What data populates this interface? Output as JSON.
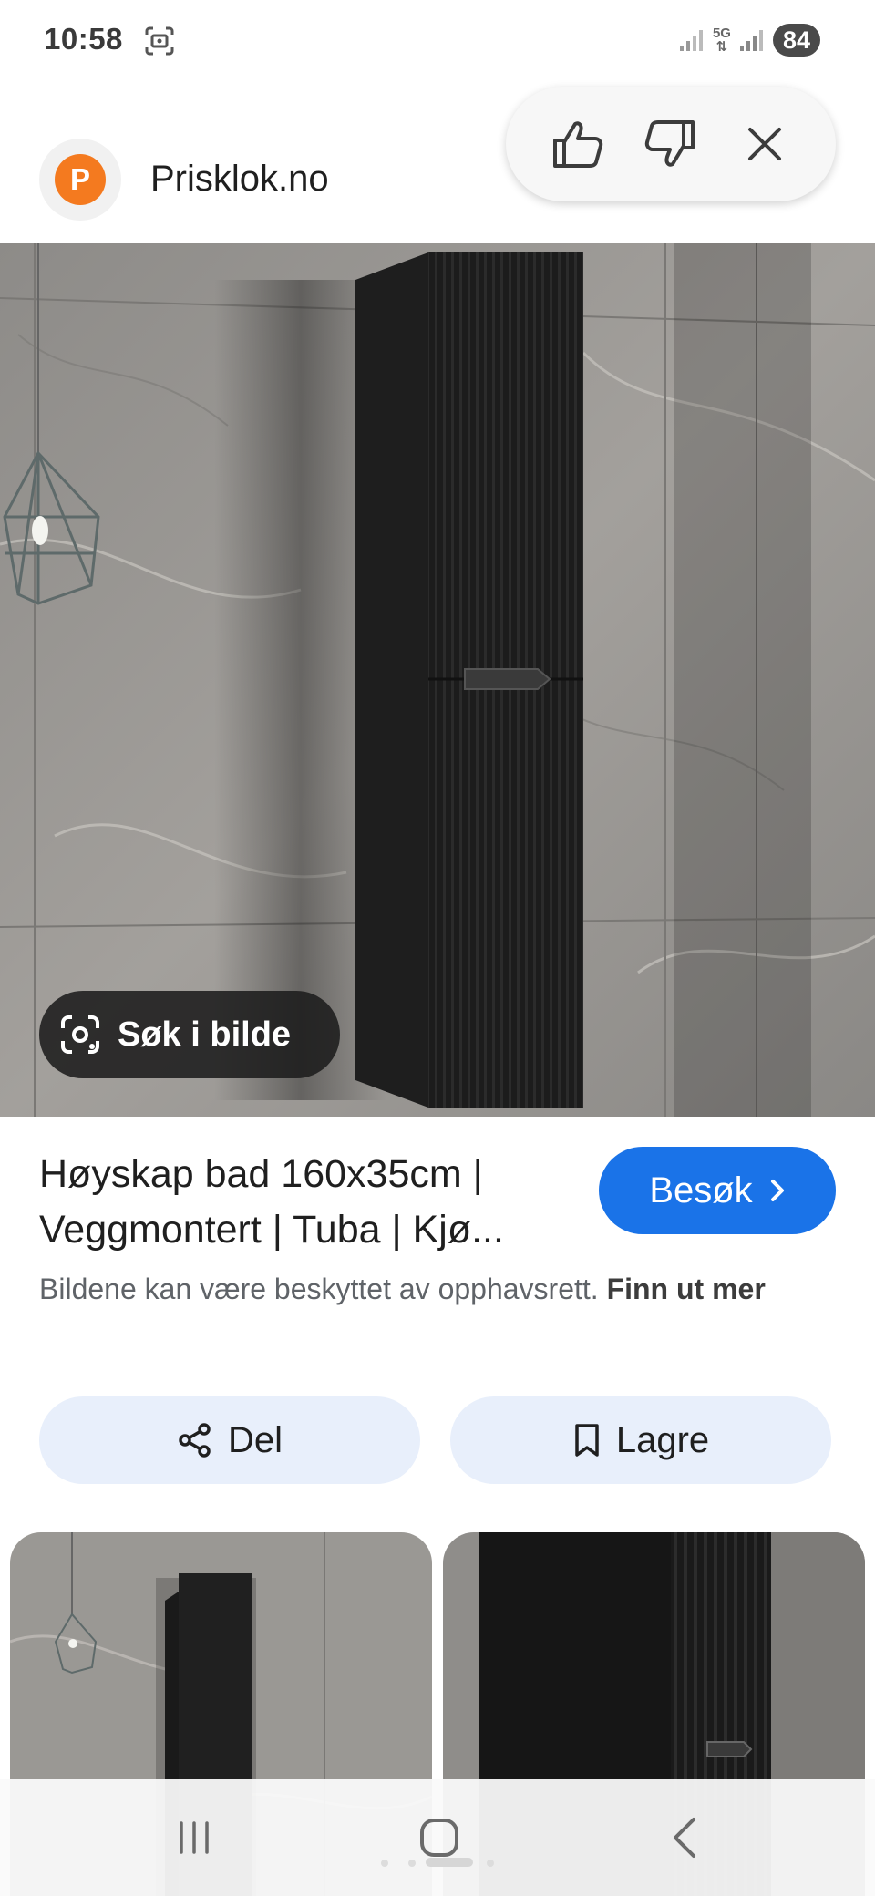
{
  "status_bar": {
    "time": "10:58",
    "network": "5G",
    "battery": "84",
    "icons": [
      "screenshot-icon",
      "signal-icon",
      "signal-icon"
    ]
  },
  "header": {
    "favicon_letter": "P",
    "site_name": "Prisklok.no",
    "favicon_color": "#f47a1f",
    "feedback_icons": [
      "thumbs-up-icon",
      "thumbs-down-icon",
      "close-icon"
    ]
  },
  "image": {
    "lens_button_label": "Søk i bilde",
    "lens_icon": "lens-icon"
  },
  "result": {
    "title": "Høyskap bad 160x35cm | Veggmontert | Tuba | Kjø...",
    "visit_label": "Besøk",
    "visit_color": "#1a73e8",
    "copyright_text": "Bildene kan være beskyttet av opphavsrett.",
    "learn_more": "Finn ut mer"
  },
  "actions": {
    "share_label": "Del",
    "share_icon": "share-icon",
    "save_label": "Lagre",
    "save_icon": "bookmark-icon",
    "button_bg": "#e8effb"
  },
  "navigation": {
    "icons": [
      "recent-apps-icon",
      "home-icon",
      "back-icon"
    ]
  }
}
